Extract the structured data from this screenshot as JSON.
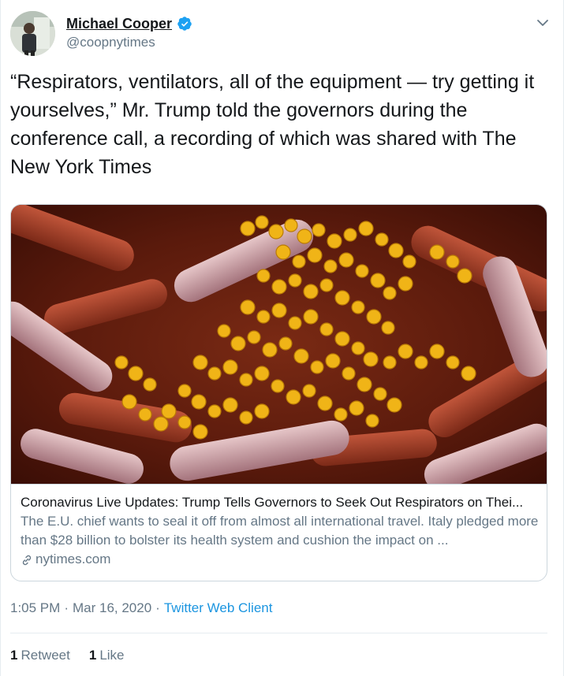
{
  "author": {
    "name": "Michael Cooper",
    "handle": "@coopnytimes"
  },
  "tweet": {
    "text": "“Respirators, ventilators, all of the equipment — try getting it yourselves,” Mr. Trump told the governors during the conference call, a recording of which was shared with The New York Times"
  },
  "link_card": {
    "title": "Coronavirus Live Updates: Trump Tells Governors to Seek Out Respirators on Thei...",
    "description": "The E.U. chief wants to seal it off from almost all international travel. Italy pledged more than $28 billion to bolster its health system and cushion the impact on ...",
    "domain": "nytimes.com"
  },
  "meta": {
    "time": "1:05 PM",
    "separator1": "·",
    "date": "Mar 16, 2020",
    "separator2": "·",
    "client": "Twitter Web Client"
  },
  "stats": {
    "retweets_count": "1",
    "retweets_label": "Retweet",
    "likes_count": "1",
    "likes_label": "Like"
  },
  "colors": {
    "accent": "#1da1f2",
    "link": "#1b95e0",
    "secondary_text": "#657786"
  },
  "icons": [
    "verified-badge-icon",
    "chevron-down-icon",
    "link-icon"
  ]
}
